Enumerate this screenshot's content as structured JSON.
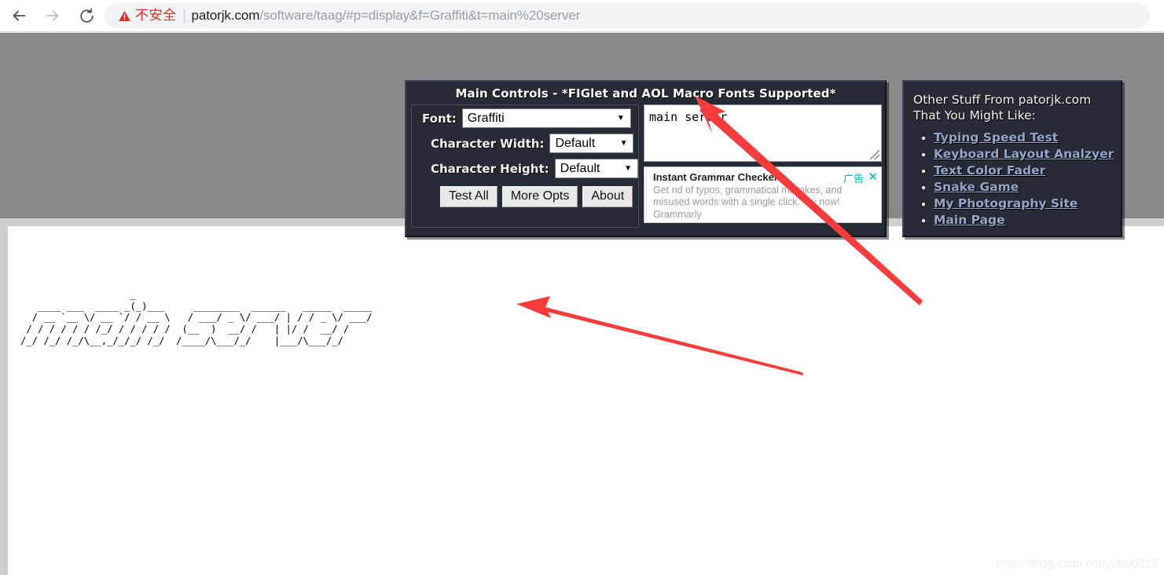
{
  "browser": {
    "back_label": "Back",
    "forward_label": "Forward",
    "reload_label": "Reload",
    "security_label": "不安全",
    "url_host": "patorjk.com",
    "url_path": "/software/taag/#p=display&f=Graffiti&t=main%20server",
    "url_full": "patorjk.com/software/taag/#p=display&f=Graffiti&t=main%20server"
  },
  "main_controls": {
    "title": "Main Controls - *FIGlet and AOL Macro Fonts Supported*",
    "font_label": "Font:",
    "font_value": "Graffiti",
    "char_width_label": "Character Width:",
    "char_width_value": "Default",
    "char_height_label": "Character Height:",
    "char_height_value": "Default",
    "buttons": [
      {
        "label": "Test All",
        "name": "test-all-button"
      },
      {
        "label": "More Opts",
        "name": "more-opts-button"
      },
      {
        "label": "About",
        "name": "about-button"
      }
    ],
    "textarea_value": "main server",
    "textarea_placeholder": ""
  },
  "ad": {
    "title": "Instant Grammar Checker",
    "body": "Get rid of typos, grammatical mistakes, and misused words with a single click. Try now!",
    "brand": "Grammarly",
    "tag": "广告",
    "close": "✕"
  },
  "other_stuff": {
    "heading_line1": "Other Stuff From patorjk.com",
    "heading_line2": "That You Might Like:",
    "links": [
      "Typing Speed Test",
      "Keyboard Layout Analzyer",
      "Text Color Fader",
      "Snake Game",
      "My Photography Site",
      "Main Page"
    ]
  },
  "output": {
    "ascii_art": "                   _                                                          \n   ____ ___  ____ _(_)___     ________  ______   _____  _____\n  / __ `__ \\/ __ `/ / __ \\   / ___/ _ \\/ ___/ | / / _ \\/ ___/\n / / / / / / /_/ / / / / /  (__  )  __/ /   | |/ /  __/ /    \n/_/ /_/ /_/\\__,_/_/_/ /_/  /____/\\___/_/    |___/\\___/_/     \n"
  },
  "watermark": "https://blog.csdn.net/yulizi0215",
  "colors": {
    "panel_bg": "#262b36",
    "panel_border": "#3d4350",
    "page_bg": "#898989",
    "link": "#94a5c8",
    "insecure": "#d93025",
    "ad_accent": "#00aecd",
    "arrow": "#f83b3b"
  }
}
